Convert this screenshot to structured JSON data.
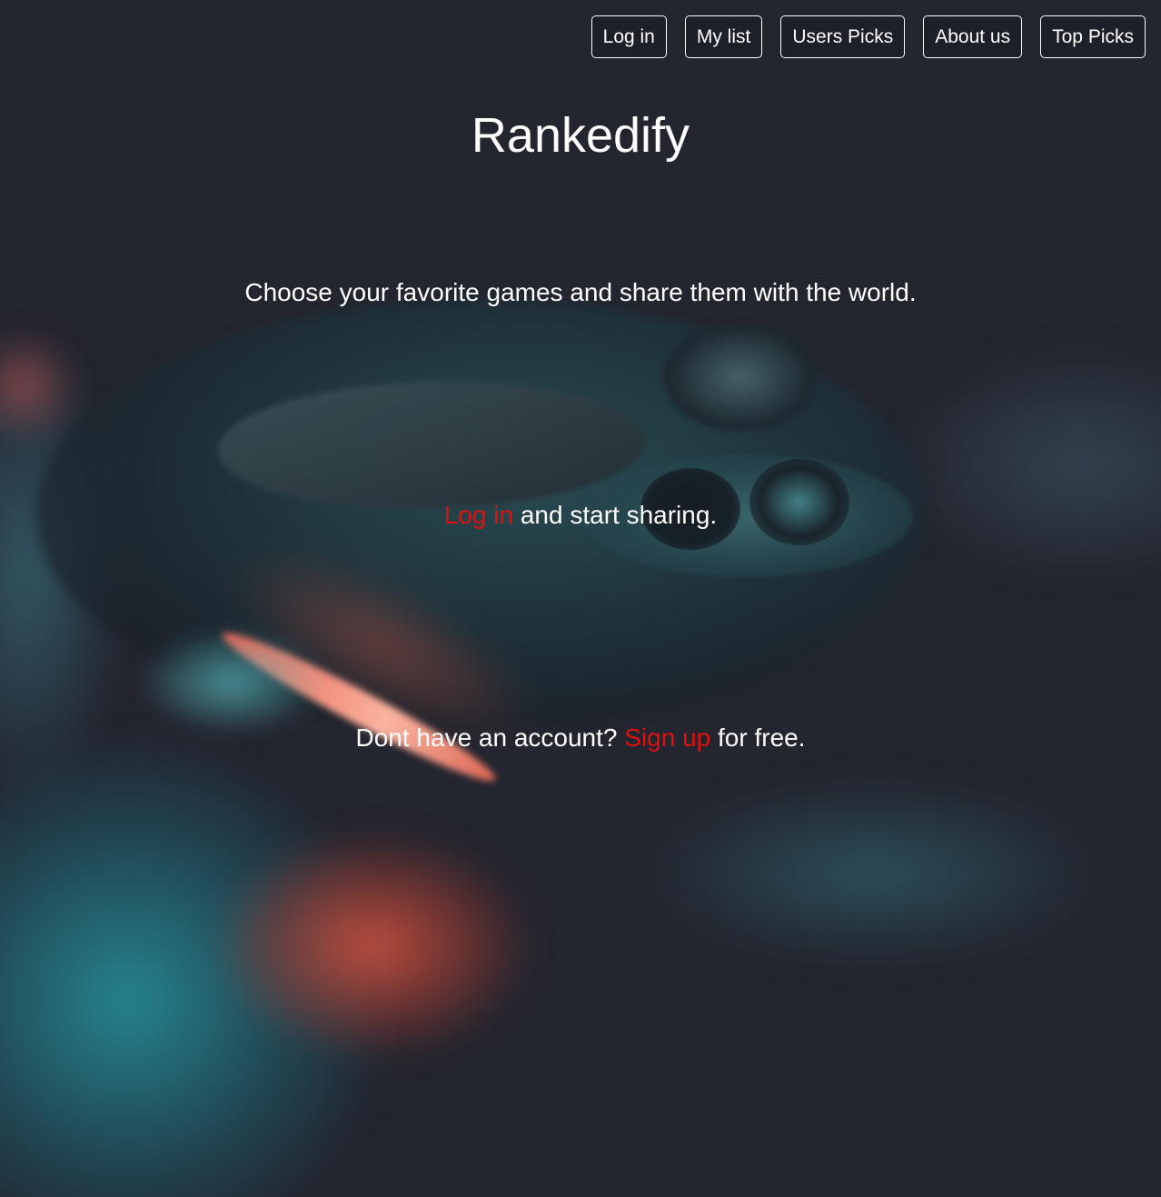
{
  "nav": {
    "items": [
      {
        "label": "Log in"
      },
      {
        "label": "My list"
      },
      {
        "label": "Users Picks"
      },
      {
        "label": "About us"
      },
      {
        "label": "Top Picks"
      }
    ]
  },
  "hero": {
    "title": "Rankedify",
    "tagline": "Choose your favorite games and share them with the world.",
    "login_link": "Log in",
    "login_suffix": " and start sharing.",
    "signup_prefix": "Dont have an account? ",
    "signup_link": "Sign up",
    "signup_suffix": " for free."
  },
  "colors": {
    "background": "#23252f",
    "text": "#ffffff",
    "link": "#e01010"
  },
  "background_image": "game-controller-photo"
}
